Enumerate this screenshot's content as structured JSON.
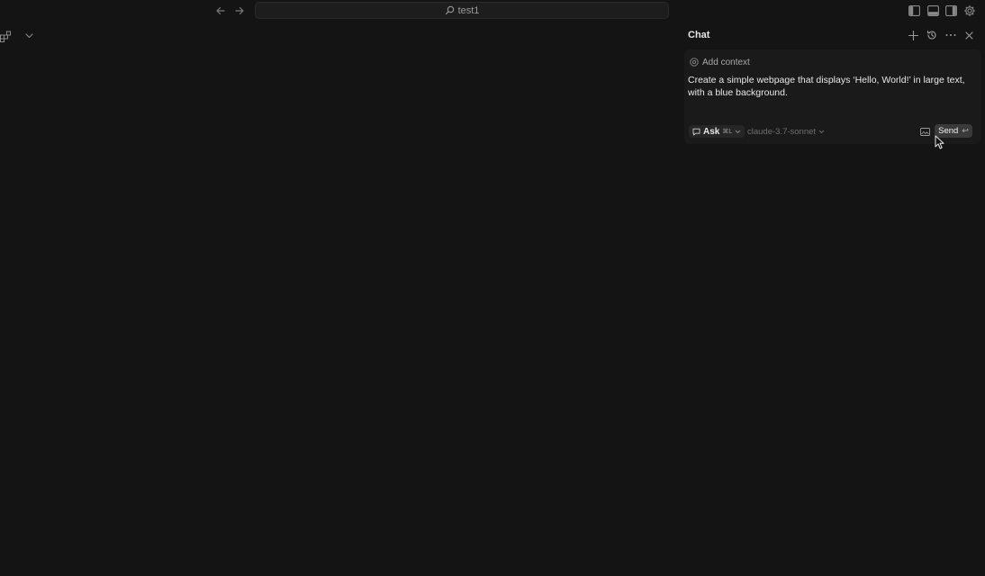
{
  "titlebar": {
    "search_text": "test1",
    "icons": {
      "back": "arrow-left-icon",
      "forward": "arrow-right-icon",
      "search": "search-icon",
      "toggle_primary_sidebar": "sidebar-left-icon",
      "toggle_panel": "panel-bottom-icon",
      "toggle_secondary_sidebar": "sidebar-right-icon",
      "settings": "gear-icon"
    }
  },
  "chat": {
    "title": "Chat",
    "add_context_label": "Add context",
    "prompt": "Create a simple webpage that displays ‘Hello, World!’ in large text, with a blue background.",
    "mode_label": "Ask",
    "mode_shortcut": "⌘L",
    "model_label": "claude-3.7-sonnet",
    "send_label": "Send",
    "send_shortcut": "↩"
  },
  "colors": {
    "background": "#141414",
    "composer": "#1a1a1a",
    "send_button": "#3a3a3a"
  }
}
